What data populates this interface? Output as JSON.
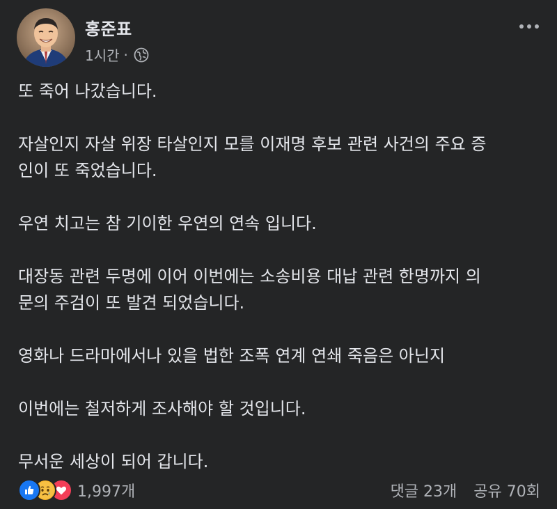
{
  "post": {
    "author": "홍준표",
    "time": "1시간",
    "separator": "·",
    "audience_icon": "globe-icon",
    "paragraphs": [
      "또 죽어 나갔습니다.",
      "자살인지 자살 위장 타살인지 모를 이재명 후보 관련 사건의 주요 증\n인이 또 죽었습니다.",
      "우연 치고는 참 기이한 우연의 연속 입니다.",
      "대장동 관련 두명에 이어 이번에는 소송비용 대납 관련 한명까지 의\n문의 주검이 또 발견 되었습니다.",
      "영화나 드라마에서나 있을 법한 조폭 연계 연쇄 죽음은 아닌지",
      "이번에는 철저하게 조사해야 할 것입니다.",
      "무서운 세상이 되어 갑니다."
    ]
  },
  "footer": {
    "reaction_icons": [
      "like-icon",
      "sad-icon",
      "love-icon"
    ],
    "reaction_count": "1,997개",
    "comments": "댓글 23개",
    "shares": "공유 70회"
  },
  "colors": {
    "background": "#242526",
    "text_primary": "#e4e6eb",
    "text_secondary": "#b0b3b8",
    "like": "#1877f2",
    "sad": "#f7b125",
    "love": "#f33e58"
  }
}
